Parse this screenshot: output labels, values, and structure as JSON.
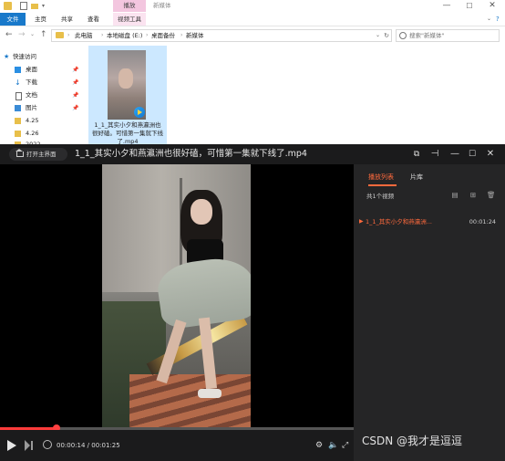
{
  "explorer": {
    "title_tab": "播放",
    "window_title": "新媒体",
    "ribbon": {
      "file": "文件",
      "home": "主页",
      "share": "共享",
      "view": "查看",
      "video_tools": "视频工具"
    },
    "breadcrumbs": [
      "此电脑",
      "本地磁盘 (E:)",
      "桌面备份",
      "新媒体"
    ],
    "search_placeholder": "搜索\"新媒体\"",
    "nav": {
      "quick_access": "快速访问",
      "items": [
        {
          "label": "桌面",
          "pinned": true
        },
        {
          "label": "下载",
          "pinned": true
        },
        {
          "label": "文档",
          "pinned": true
        },
        {
          "label": "图片",
          "pinned": true
        },
        {
          "label": "4.25",
          "pinned": false
        },
        {
          "label": "4.26",
          "pinned": false
        },
        {
          "label": "2022",
          "pinned": false
        }
      ]
    },
    "file_name": "1_1_其实小夕和燕瀛洲也很好磕。可惜第一集就下线了.mp4"
  },
  "player": {
    "open_main": "打开主界面",
    "title": "1_1_其实小夕和燕瀛洲也很好磕，可惜第一集就下线了.mp4",
    "current_time": "00:00:14",
    "total_time": "00:01:25",
    "progress": 0.16,
    "accent_color": "#ff6a3d",
    "sidebar": {
      "tab_playlist": "播放列表",
      "tab_library": "片库",
      "count": "共1个视频",
      "items": [
        {
          "name": "1_1_其实小夕和燕瀛洲...",
          "duration": "00:01:24"
        }
      ]
    }
  },
  "watermark": "CSDN @我才是逗逗"
}
